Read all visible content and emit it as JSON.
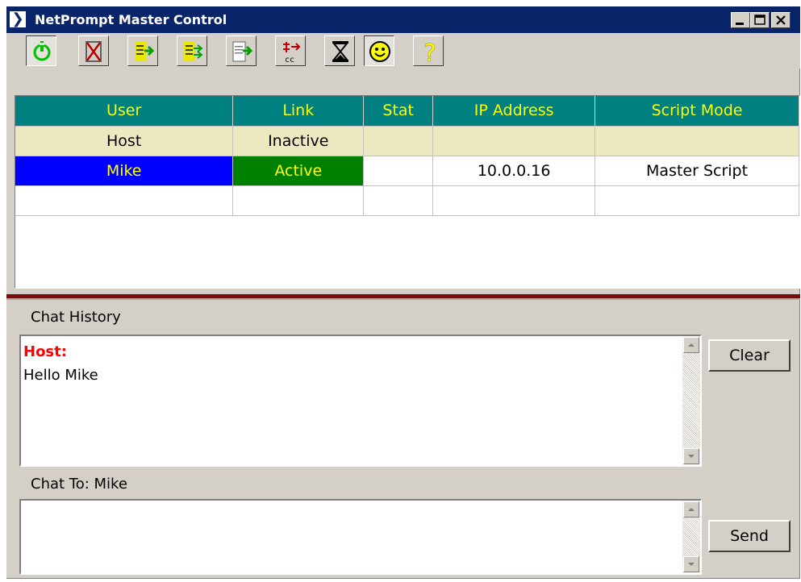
{
  "window": {
    "title": "NetPrompt Master Control"
  },
  "toolbar": {
    "buttons": [
      "power-icon",
      "stop-icon",
      "script-forward-icon",
      "script-forward-all-icon",
      "document-send-icon",
      "closed-caption-icon",
      "hourglass-icon",
      "smiley-icon",
      "help-icon"
    ]
  },
  "grid": {
    "headers": [
      "User",
      "Link",
      "Stat",
      "IP Address",
      "Script Mode"
    ],
    "rows": [
      {
        "user": "Host",
        "link": "Inactive",
        "stat": "",
        "ip": "",
        "mode": ""
      },
      {
        "user": "Mike",
        "link": "Active",
        "stat": "",
        "ip": "10.0.0.16",
        "mode": "Master Script"
      },
      {
        "user": "",
        "link": "",
        "stat": "",
        "ip": "",
        "mode": ""
      }
    ]
  },
  "chat": {
    "history_label": "Chat History",
    "history_sender": "Host:",
    "history_message": "Hello Mike",
    "to_label": "Chat To: Mike",
    "message_value": "",
    "clear_label": "Clear",
    "send_label": "Send"
  },
  "colors": {
    "title_bar": "#0a246a",
    "grid_header": "#008080",
    "header_text": "#ffff00",
    "host_row": "#ece9c0",
    "selected_user": "#0000ff",
    "active_link": "#008000",
    "sender": "#ff0000"
  }
}
